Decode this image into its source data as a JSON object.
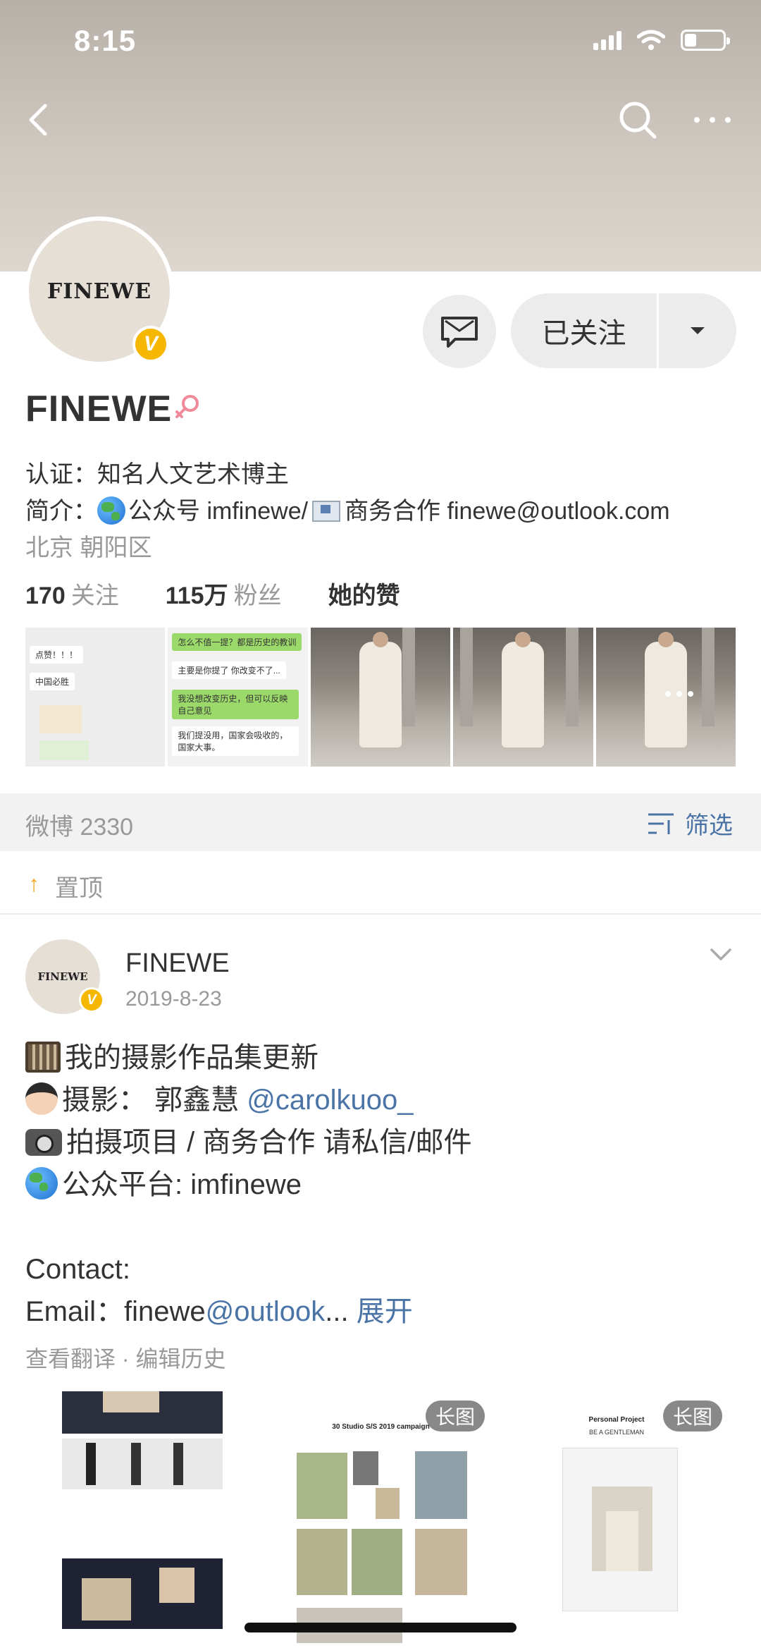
{
  "status_bar": {
    "time": "8:15",
    "battery_level": 0.3
  },
  "profile": {
    "avatar_text": "FINEWE",
    "verified_badge": "V",
    "name": "FINEWE",
    "gender_icon": "female-icon",
    "follow_label": "已关注",
    "cert_label": "认证：",
    "cert_value": "知名人文艺术博主",
    "bio_label": "简介：",
    "bio_text1": "公众号 imfinewe/",
    "bio_text2": "商务合作 finewe@outlook.com",
    "location": "北京 朝阳区",
    "following_count": "170",
    "following_label": "关注",
    "followers_count": "115万",
    "followers_label": "粉丝",
    "likes_label": "她的赞"
  },
  "album": {
    "chat1": [
      "点赞！！！",
      "中国必胜"
    ],
    "chat2": [
      "怎么不值一提？都是历史的教训",
      "主要是你提了 你改变不了...",
      "我没想改变历史，但可以反映自己意见",
      "我们提没用，国家会吸收的，国家大事。"
    ]
  },
  "feed_bar": {
    "count_label": "微博 2330",
    "filter_label": "筛选"
  },
  "pinned_label": "置顶",
  "post": {
    "avatar_text": "FINEWE",
    "author": "FINEWE",
    "date": "2019-8-23",
    "line1": "我的摄影作品集更新",
    "line2_text": "摄影： 郭鑫慧 ",
    "line2_mention": "@carolkuoo_",
    "line3": "拍摄项目 / 商务合作 请私信/邮件",
    "line4": "公众平台: imfinewe",
    "line5": "Contact:",
    "line6_text": "Email：finewe",
    "line6_link": "@outlook",
    "line6_ellipsis": "...",
    "expand_label": "展开",
    "meta": "查看翻译 · 编辑历史",
    "image_tags": [
      "长图",
      "长图"
    ],
    "image2_caption": "30 Studio S/S 2019 campaign",
    "image3_title": "Personal Project",
    "image3_subtitle": "BE A GENTLEMAN"
  },
  "colors": {
    "accent_link": "#4a73a6",
    "verified": "#f5b700",
    "pinned_arrow": "#f5a623"
  }
}
